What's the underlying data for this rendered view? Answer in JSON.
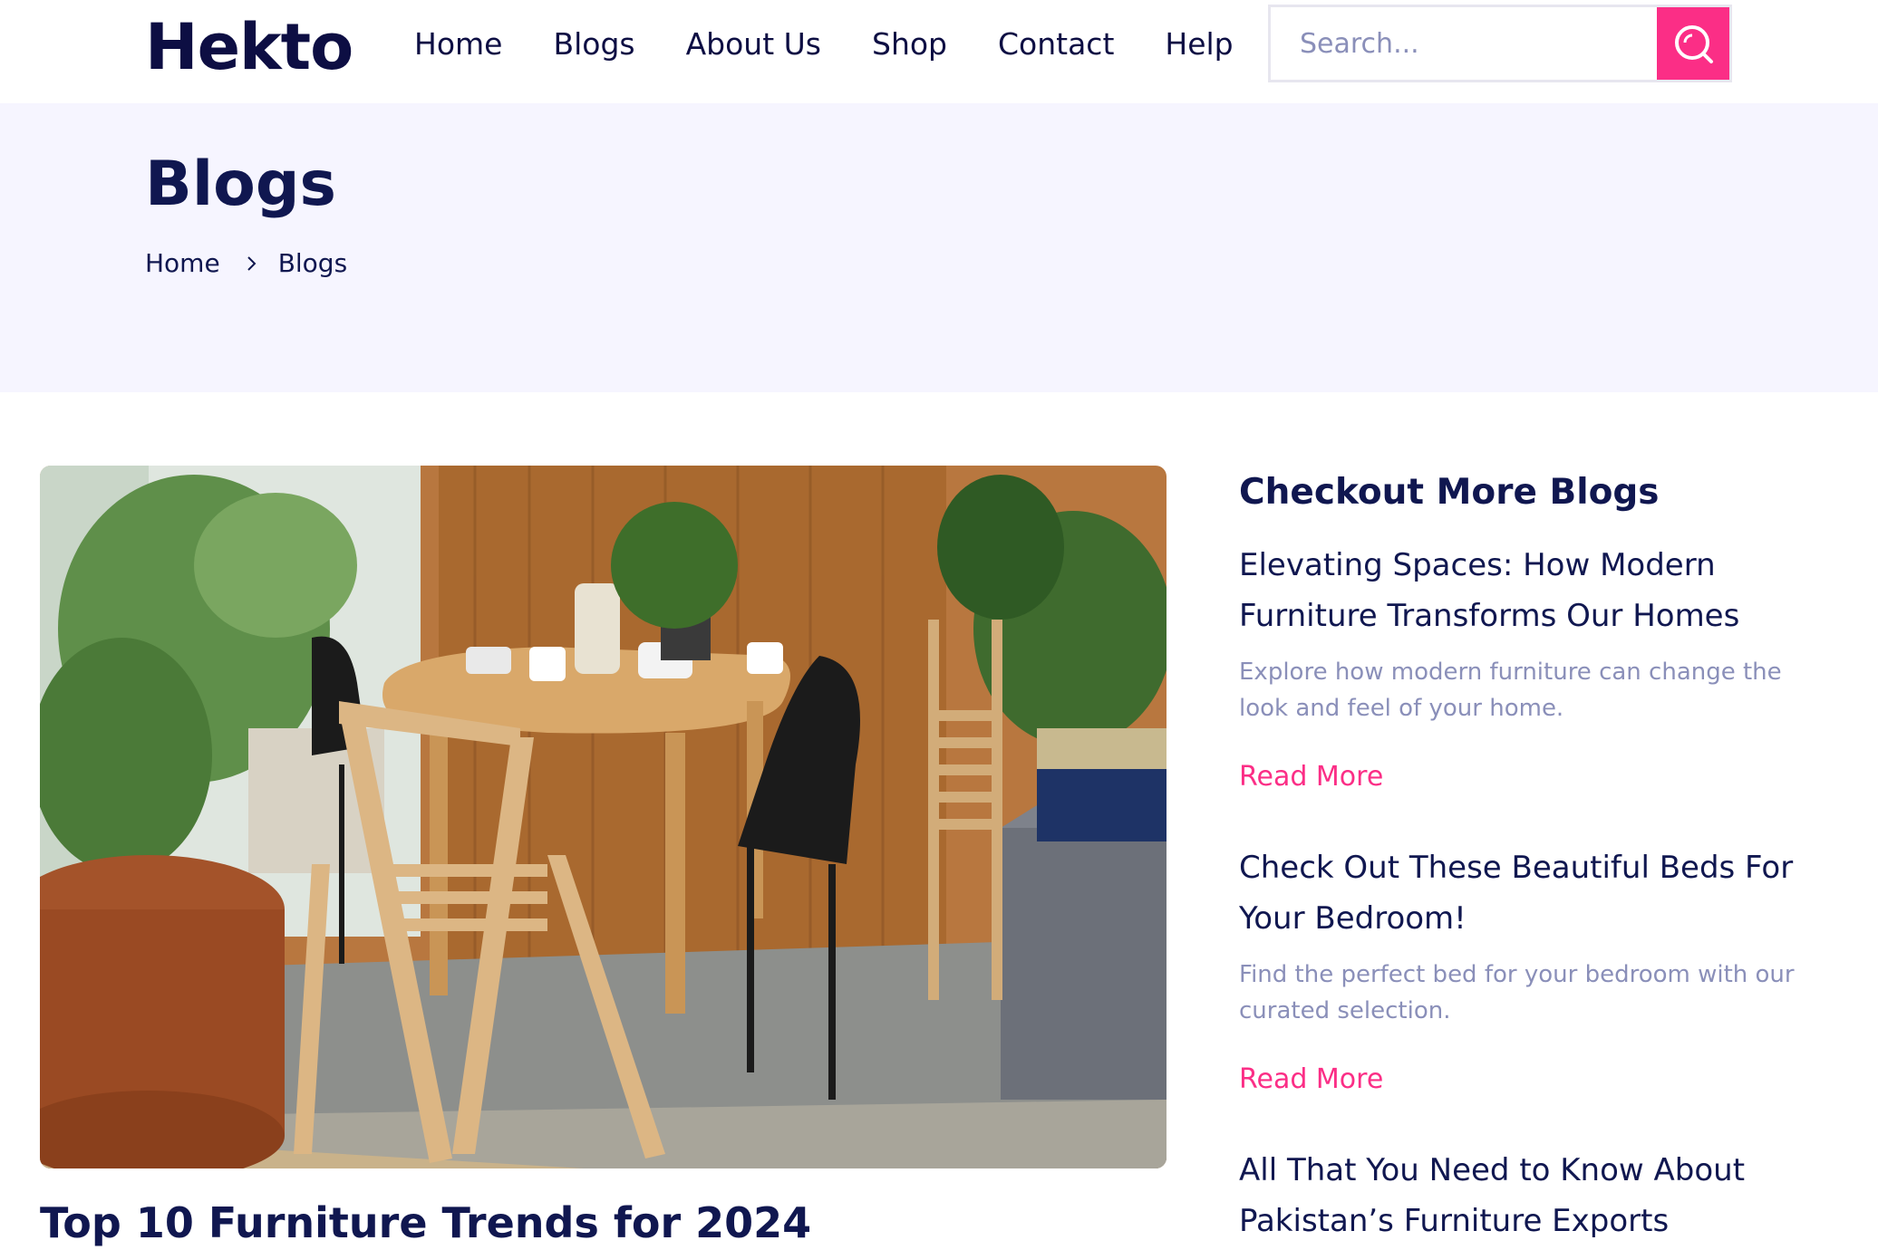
{
  "header": {
    "logo": "Hekto",
    "nav": [
      "Home",
      "Blogs",
      "About Us",
      "Shop",
      "Contact",
      "Help"
    ],
    "search": {
      "placeholder": "Search..."
    }
  },
  "banner": {
    "title": "Blogs",
    "breadcrumb": [
      "Home",
      "Blogs"
    ]
  },
  "main": {
    "post_title": "Top 10 Furniture Trends for 2024"
  },
  "sidebar": {
    "heading": "Checkout More Blogs",
    "items": [
      {
        "title": "Elevating Spaces: How Modern Furniture Transforms Our Homes",
        "description": "Explore how modern furniture can change the look and feel of your home.",
        "link": "Read More"
      },
      {
        "title": "Check Out These Beautiful Beds For Your Bedroom!",
        "description": "Find the perfect bed for your bedroom with our curated selection.",
        "link": "Read More"
      },
      {
        "title": "All That You Need to Know About Pakistan’s Furniture Exports",
        "description": "",
        "link": ""
      }
    ]
  },
  "colors": {
    "primary": "#101750",
    "accent": "#fb2e86",
    "banner_bg": "#f6f5ff",
    "muted": "#8a8fb9"
  }
}
